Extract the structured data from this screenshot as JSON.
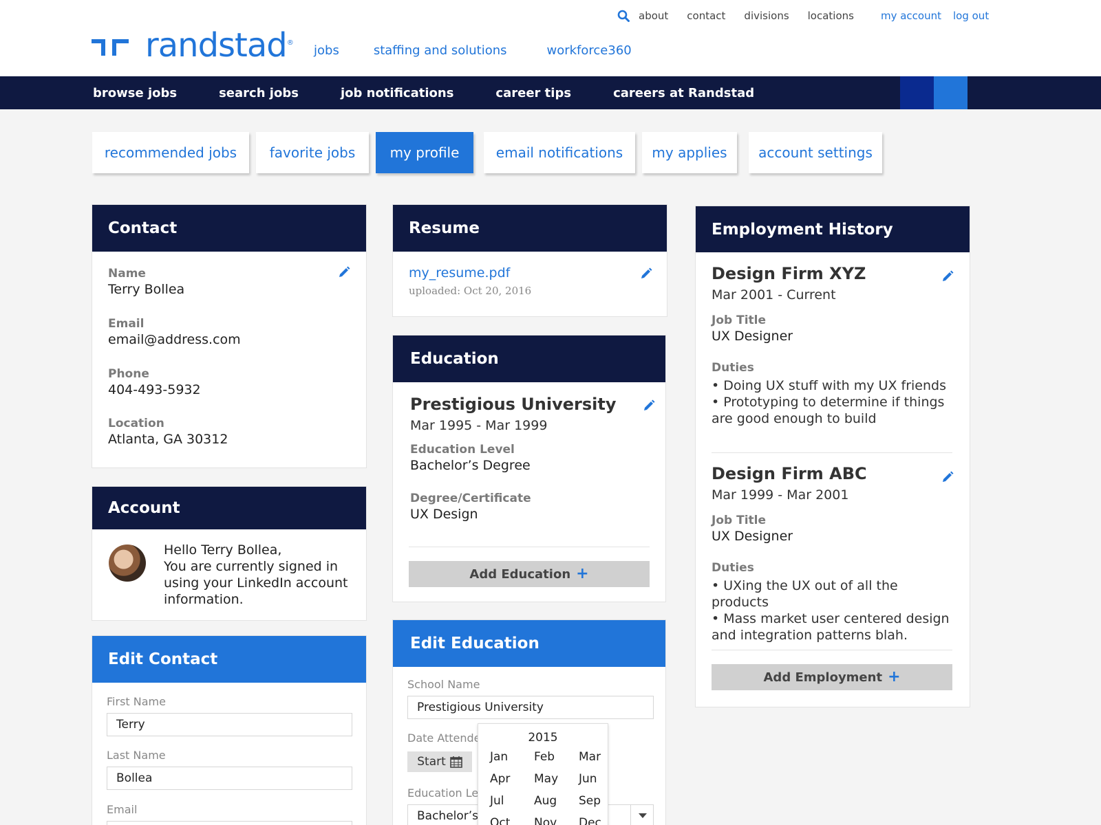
{
  "brand": {
    "name": "randstad",
    "colors": {
      "navy": "#0f1941",
      "blue": "#2175d9",
      "gray_button": "#d0d0d0"
    }
  },
  "utility_nav": {
    "search_icon": "search-icon",
    "links": [
      "about",
      "contact",
      "divisions",
      "locations"
    ],
    "account": "my account",
    "logout": "log out"
  },
  "main_nav": [
    "jobs",
    "staffing and solutions",
    "workforce360"
  ],
  "dark_nav": [
    "browse jobs",
    "search jobs",
    "job notifications",
    "career tips",
    "careers at Randstad"
  ],
  "tabs": [
    {
      "label": "recommended jobs",
      "active": false
    },
    {
      "label": "favorite jobs",
      "active": false
    },
    {
      "label": "my profile",
      "active": true
    },
    {
      "label": "email notifications",
      "active": false
    },
    {
      "label": "my applies",
      "active": false
    },
    {
      "label": "account settings",
      "active": false
    }
  ],
  "contact": {
    "title": "Contact",
    "fields": [
      {
        "label": "Name",
        "value": "Terry Bollea"
      },
      {
        "label": "Email",
        "value": "email@address.com"
      },
      {
        "label": "Phone",
        "value": "404-493-5932"
      },
      {
        "label": "Location",
        "value": "Atlanta, GA 30312"
      }
    ]
  },
  "account": {
    "title": "Account",
    "message": [
      "Hello Terry Bollea,",
      "You are currently signed in",
      "using your LinkedIn account",
      "information."
    ]
  },
  "edit_contact": {
    "title": "Edit Contact",
    "first_name_label": "First Name",
    "first_name": "Terry",
    "last_name_label": "Last Name",
    "last_name": "Bollea",
    "email_label": "Email"
  },
  "resume": {
    "title": "Resume",
    "file": "my_resume.pdf",
    "uploaded": "uploaded: Oct 20, 2016"
  },
  "education": {
    "title": "Education",
    "school": "Prestigious University",
    "dates": "Mar 1995 - Mar 1999",
    "level_label": "Education Level",
    "level": "Bachelor’s Degree",
    "degree_label": "Degree/Certificate",
    "degree": "UX Design",
    "add_label": "Add Education",
    "add_icon": "plus-icon"
  },
  "edit_education": {
    "title": "Edit Education",
    "school_label": "School Name",
    "school_value": "Prestigious University",
    "date_label": "Date Attende",
    "start_label": "Start",
    "calendar_icon": "calendar-icon",
    "level_label": "Education Lev",
    "level_value": "Bachelor’s",
    "picker": {
      "year": "2015",
      "months": [
        "Jan",
        "Feb",
        "Mar",
        "Apr",
        "May",
        "Jun",
        "Jul",
        "Aug",
        "Sep",
        "Oct",
        "Nov",
        "Dec"
      ]
    }
  },
  "employment": {
    "title": "Employment History",
    "jobs": [
      {
        "company": "Design Firm XYZ",
        "dates": "Mar 2001 - Current",
        "title_label": "Job Title",
        "title": "UX Designer",
        "duties_label": "Duties",
        "duties": [
          "• Doing UX stuff with my UX friends",
          "• Prototyping to determine if things",
          "are good enough to build"
        ]
      },
      {
        "company": "Design Firm ABC",
        "dates": "Mar 1999 - Mar 2001",
        "title_label": "Job Title",
        "title": "UX Designer",
        "duties_label": "Duties",
        "duties": [
          "• UXing the UX out of all the products",
          "• Mass market user centered design",
          "and integration patterns blah."
        ]
      }
    ],
    "add_label": "Add Employment"
  }
}
